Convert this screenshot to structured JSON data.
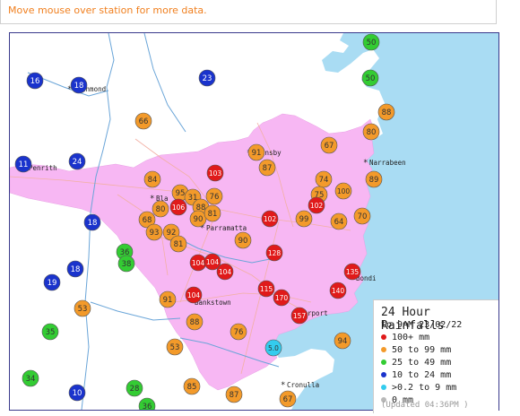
{
  "hint": "Move mouse over station for more data.",
  "colors": {
    "red": "#e01a1a",
    "orange": "#f39a2a",
    "green": "#33cc33",
    "blue": "#1a33cc",
    "cyan": "#33ccee",
    "grey": "#b8b8b8",
    "rain_area": "#f7b7f3",
    "sea": "#a9dcf3"
  },
  "places": [
    {
      "name": "Richmond"
    },
    {
      "name": "Penrith"
    },
    {
      "name": "Hornsby"
    },
    {
      "name": "Narrabeen"
    },
    {
      "name": "Bla"
    },
    {
      "name": "Parramatta"
    },
    {
      "name": "Bondi"
    },
    {
      "name": "Bankstown"
    },
    {
      "name": "Airport"
    },
    {
      "name": "Cronulla"
    }
  ],
  "stations": [
    {
      "v": "50",
      "c": "green"
    },
    {
      "v": "16",
      "c": "blue"
    },
    {
      "v": "18",
      "c": "blue"
    },
    {
      "v": "23",
      "c": "blue"
    },
    {
      "v": "50",
      "c": "green"
    },
    {
      "v": "88",
      "c": "orange"
    },
    {
      "v": "66",
      "c": "orange"
    },
    {
      "v": "80",
      "c": "orange"
    },
    {
      "v": "67",
      "c": "orange"
    },
    {
      "v": "91",
      "c": "orange"
    },
    {
      "v": "11",
      "c": "blue"
    },
    {
      "v": "24",
      "c": "blue"
    },
    {
      "v": "87",
      "c": "orange"
    },
    {
      "v": "103",
      "c": "red"
    },
    {
      "v": "74",
      "c": "orange"
    },
    {
      "v": "89",
      "c": "orange"
    },
    {
      "v": "84",
      "c": "orange"
    },
    {
      "v": "95",
      "c": "orange"
    },
    {
      "v": "31",
      "c": "orange"
    },
    {
      "v": "76",
      "c": "orange"
    },
    {
      "v": "75",
      "c": "orange"
    },
    {
      "v": "100",
      "c": "orange"
    },
    {
      "v": "80",
      "c": "orange"
    },
    {
      "v": "106",
      "c": "red"
    },
    {
      "v": "88",
      "c": "orange"
    },
    {
      "v": "102",
      "c": "red"
    },
    {
      "v": "70",
      "c": "orange"
    },
    {
      "v": "90",
      "c": "orange"
    },
    {
      "v": "81",
      "c": "orange"
    },
    {
      "v": "68",
      "c": "orange"
    },
    {
      "v": "102",
      "c": "red"
    },
    {
      "v": "99",
      "c": "orange"
    },
    {
      "v": "64",
      "c": "orange"
    },
    {
      "v": "18",
      "c": "blue"
    },
    {
      "v": "93",
      "c": "orange"
    },
    {
      "v": "92",
      "c": "orange"
    },
    {
      "v": "90",
      "c": "orange"
    },
    {
      "v": "81",
      "c": "orange"
    },
    {
      "v": "36",
      "c": "green"
    },
    {
      "v": "128",
      "c": "red"
    },
    {
      "v": "38",
      "c": "green"
    },
    {
      "v": "104",
      "c": "red"
    },
    {
      "v": "104",
      "c": "red"
    },
    {
      "v": "18",
      "c": "blue"
    },
    {
      "v": "104",
      "c": "red"
    },
    {
      "v": "135",
      "c": "red"
    },
    {
      "v": "19",
      "c": "blue"
    },
    {
      "v": "115",
      "c": "red"
    },
    {
      "v": "170",
      "c": "red"
    },
    {
      "v": "140",
      "c": "red"
    },
    {
      "v": "91",
      "c": "orange"
    },
    {
      "v": "104",
      "c": "red"
    },
    {
      "v": "53",
      "c": "orange"
    },
    {
      "v": "157",
      "c": "red"
    },
    {
      "v": "88",
      "c": "orange"
    },
    {
      "v": "35",
      "c": "green"
    },
    {
      "v": "76",
      "c": "orange"
    },
    {
      "v": "94",
      "c": "orange"
    },
    {
      "v": "53",
      "c": "orange"
    },
    {
      "v": "5.0",
      "c": "cyan"
    },
    {
      "v": "34",
      "c": "green"
    },
    {
      "v": "10",
      "c": "blue"
    },
    {
      "v": "28",
      "c": "green"
    },
    {
      "v": "85",
      "c": "orange"
    },
    {
      "v": "87",
      "c": "orange"
    },
    {
      "v": "67",
      "c": "orange"
    },
    {
      "v": "36",
      "c": "green"
    }
  ],
  "legend": {
    "title": "24 Hour Rainfalls",
    "subtitle": "to 9AM 23/02/22",
    "items": [
      {
        "label": "100+ mm",
        "c": "red"
      },
      {
        "label": "50  to 99 mm",
        "c": "orange"
      },
      {
        "label": "25  to 49 mm",
        "c": "green"
      },
      {
        "label": "10  to 24 mm",
        "c": "blue"
      },
      {
        "label": ">0.2 to 9 mm",
        "c": "cyan"
      },
      {
        "label": "0  mm",
        "c": "grey"
      }
    ],
    "updated": "(Updated 04:36PM  )"
  }
}
